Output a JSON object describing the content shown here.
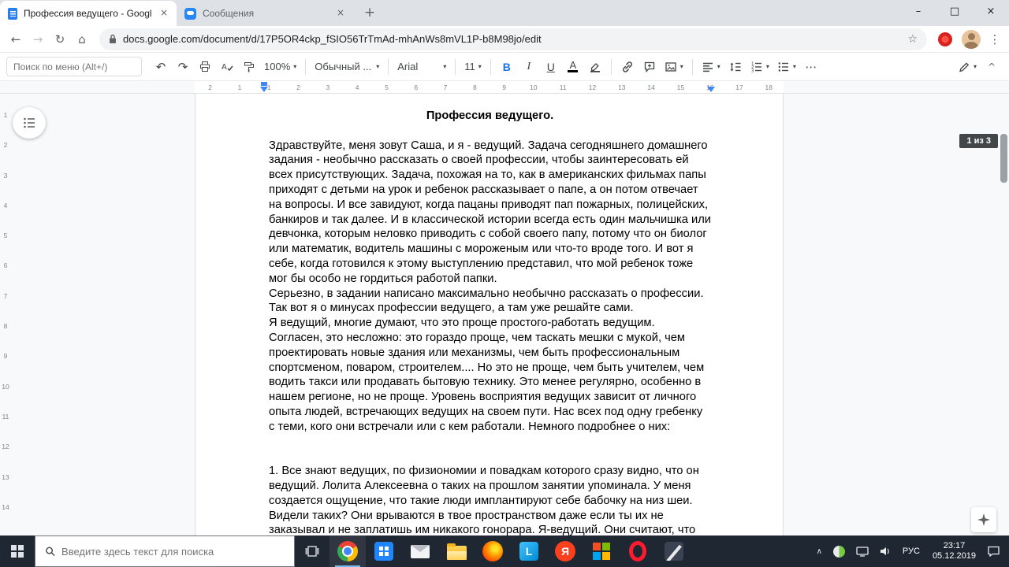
{
  "icons": {
    "back": "←",
    "forward": "→",
    "reload": "↻",
    "home": "⌂",
    "star": "☆",
    "kebab": "⋮",
    "min": "–",
    "max": "□",
    "close": "×",
    "tab_close": "×",
    "new_tab": "+",
    "undo": "↶",
    "redo": "↷",
    "caret": "▾",
    "more": "⋯",
    "collapse": "^",
    "tray_chevron": "∧"
  },
  "browser": {
    "tab1_title": "Профессия ведущего - Google",
    "tab2_title": "Сообщения",
    "url": "docs.google.com/document/d/17P5OR4ckp_fSIO56TrTmAd-mhAnWs8mVL1P-b8M98jo/edit"
  },
  "docs_toolbar": {
    "menu_search_placeholder": "Поиск по меню (Alt+/)",
    "zoom": "100%",
    "style_name": "Обычный ...",
    "font_name": "Arial",
    "font_size": "11",
    "bold": "B",
    "italic": "I",
    "underline": "U",
    "text_color_letter": "A"
  },
  "ruler": {
    "marks": [
      "2",
      "1",
      "1",
      "2",
      "3",
      "4",
      "5",
      "6",
      "7",
      "8",
      "9",
      "10",
      "11",
      "12",
      "13",
      "14",
      "15",
      "16",
      "17",
      "18"
    ]
  },
  "vruler": {
    "marks": [
      "1",
      "2",
      "3",
      "4",
      "5",
      "6",
      "7",
      "8",
      "9",
      "10",
      "11",
      "12",
      "13",
      "14"
    ]
  },
  "document": {
    "title": "Профессия ведущего.",
    "page_badge": "1 из 3",
    "paragraphs": [
      "Здравствуйте, меня зовут Саша, и я - ведущий. Задача сегодняшнего домашнего задания - необычно рассказать о своей профессии, чтобы заинтересовать ей всех присутствующих. Задача, похожая на то, как в американских фильмах папы приходят с детьми на урок и ребенок рассказывает о папе, а он потом отвечает на вопросы. И все завидуют, когда пацаны приводят пап пожарных, полицейских, банкиров и так далее. И в классической истории всегда есть один мальчишка или девчонка, которым неловко приводить с собой своего папу, потому что он биолог или математик, водитель машины с мороженым или что-то вроде того. И вот я себе, когда готовился к этому выступлению представил, что мой ребенок тоже мог бы особо не гордиться работой папки.",
      "Серьезно, в задании написано максимально необычно рассказать о профессии. Так вот я о минусах профессии ведущего, а там уже решайте сами.",
      "Я ведущий, многие думают, что это проще простого-работать ведущим. Согласен, это несложно: это гораздо проще, чем таскать мешки с мукой, чем проектировать новые здания или механизмы, чем быть профессиональным спортсменом, поваром, строителем.... Но это не проще, чем быть учителем, чем водить такси или продавать бытовую технику. Это менее регулярно, особенно в нашем регионе, но не проще. Уровень восприятия ведущих зависит от личного опыта людей, встречающих ведущих на своем пути. Нас всех под одну гребенку с теми, кого они встречали или с кем работали. Немного подробнее о них:",
      "1. Все знают ведущих, по физиономии и повадкам которого сразу видно, что он ведущий. Лолита Алексеевна о таких на прошлом занятии упоминала. У меня создается ощущение, что такие люди имплантируют себе бабочку на низ шеи. Видели таких? Они врываются в твое пространством даже если ты их не заказывал и не заплатишь им никакого гонорара. Я-ведущий. Они считают, что любое их появление должно сопровождаться громким голосом, сценическим, как они его себе"
    ]
  },
  "taskbar": {
    "search_placeholder": "Введите здесь текст для поиска",
    "language": "РУС",
    "time": "23:17",
    "date": "05.12.2019",
    "yandex_letter": "Я",
    "app_l_letter": "L"
  }
}
